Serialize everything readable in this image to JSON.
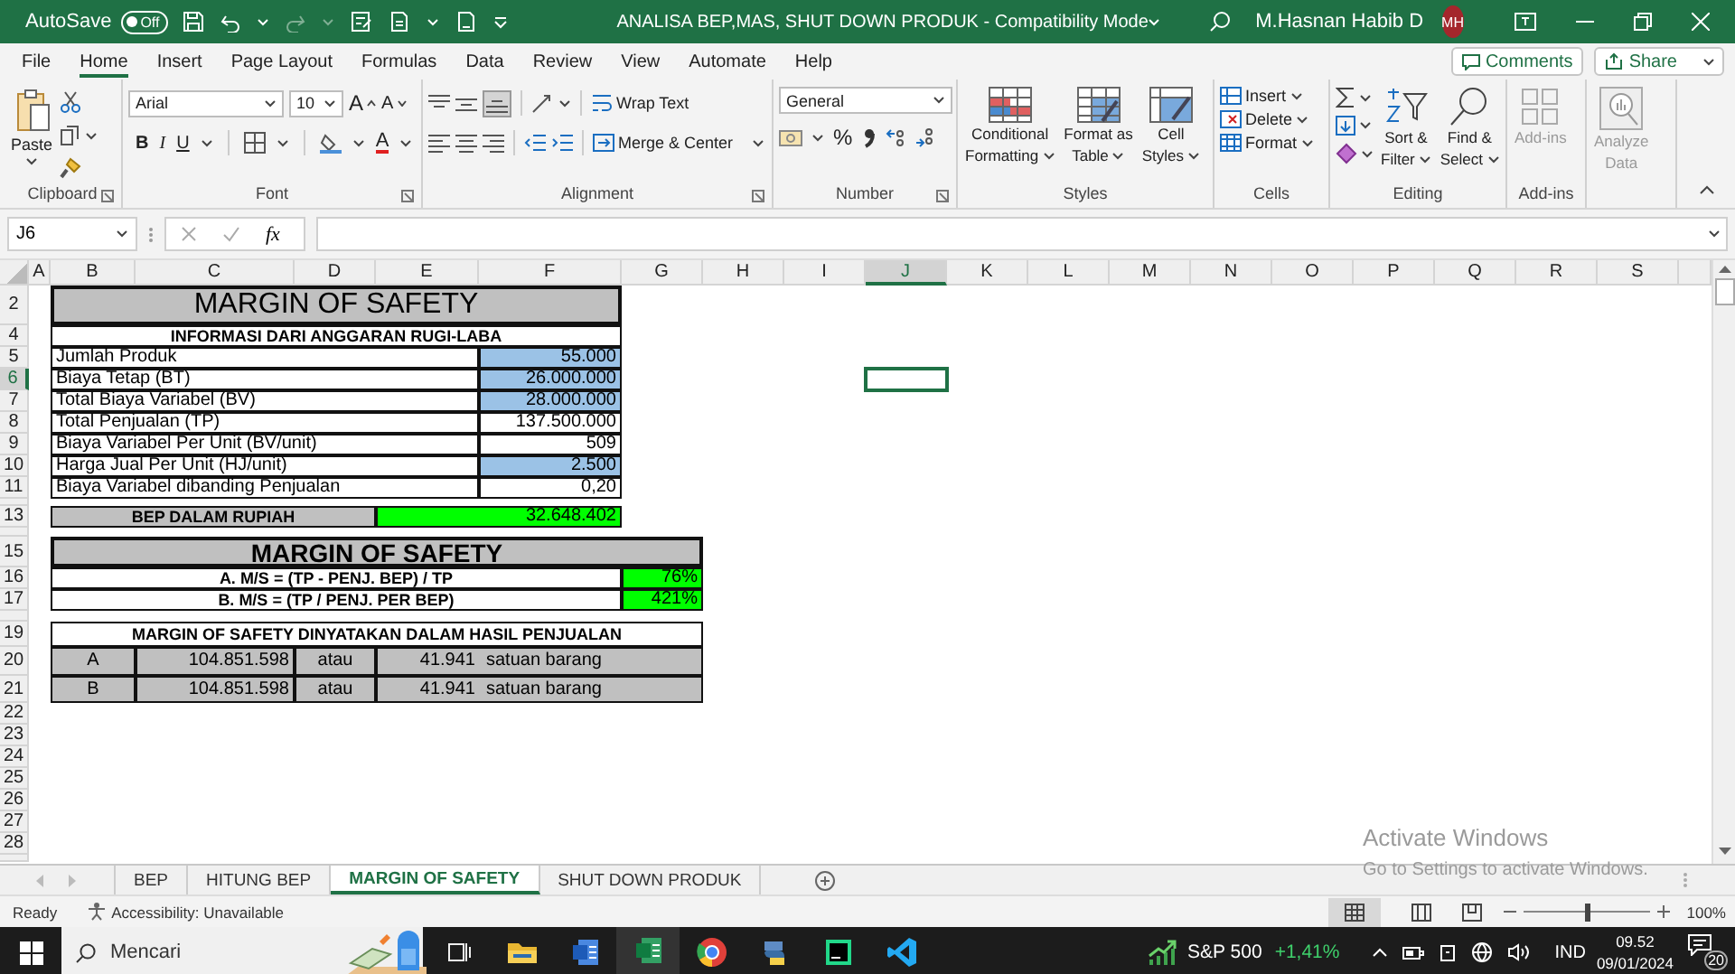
{
  "title_bar": {
    "autosave_label": "AutoSave",
    "autosave_toggle": {
      "label": "Off",
      "on": false
    },
    "document_title": "ANALISA BEP,MAS, SHUT DOWN PRODUK  -  Compatibility Mode",
    "user_name": "M.Hasnan Habib D",
    "avatar_initials": "MH"
  },
  "ribbon_tabs": [
    {
      "label": "File",
      "selected": false
    },
    {
      "label": "Home",
      "selected": true
    },
    {
      "label": "Insert",
      "selected": false
    },
    {
      "label": "Page Layout",
      "selected": false
    },
    {
      "label": "Formulas",
      "selected": false
    },
    {
      "label": "Data",
      "selected": false
    },
    {
      "label": "Review",
      "selected": false
    },
    {
      "label": "View",
      "selected": false
    },
    {
      "label": "Automate",
      "selected": false
    },
    {
      "label": "Help",
      "selected": false
    }
  ],
  "comments_button": "Comments",
  "share_button": "Share",
  "ribbon": {
    "clipboard": {
      "paste": "Paste",
      "label": "Clipboard"
    },
    "font": {
      "font_name": "Arial",
      "font_size": "10",
      "grow": "A",
      "shrink": "A",
      "bold": "B",
      "italic": "I",
      "underline": "U",
      "font_color": "A",
      "label": "Font"
    },
    "alignment": {
      "wrap_text": "Wrap Text",
      "merge": "Merge & Center",
      "label": "Alignment"
    },
    "number": {
      "format": "General",
      "percent": "%",
      "label": "Number"
    },
    "styles": {
      "buttons": [
        {
          "lines": [
            "Conditional",
            "Formatting"
          ]
        },
        {
          "lines": [
            "Format as",
            "Table"
          ]
        },
        {
          "lines": [
            "Cell",
            "Styles"
          ]
        }
      ],
      "label": "Styles"
    },
    "cells": {
      "buttons": [
        "Insert",
        "Delete",
        "Format"
      ],
      "label": "Cells"
    },
    "editing": {
      "buttons": [
        {
          "lines": [
            "Sort &",
            "Filter"
          ]
        },
        {
          "lines": [
            "Find &",
            "Select"
          ]
        }
      ],
      "label": "Editing"
    },
    "addins": {
      "button": {
        "lines": [
          "Add-ins"
        ],
        "disabled": true
      },
      "label": "Add-ins"
    },
    "analyze": {
      "button": {
        "lines": [
          "Analyze",
          "Data"
        ],
        "disabled": true
      }
    }
  },
  "formula_bar": {
    "name_box": "J6",
    "function_label": "fx"
  },
  "sheet": {
    "columns": [
      {
        "label": "A",
        "selected": false
      },
      {
        "label": "B",
        "selected": false
      },
      {
        "label": "C",
        "selected": false
      },
      {
        "label": "D",
        "selected": false
      },
      {
        "label": "E",
        "selected": false
      },
      {
        "label": "F",
        "selected": false
      },
      {
        "label": "G",
        "selected": false
      },
      {
        "label": "H",
        "selected": false
      },
      {
        "label": "I",
        "selected": false
      },
      {
        "label": "J",
        "selected": true
      },
      {
        "label": "K",
        "selected": false
      },
      {
        "label": "L",
        "selected": false
      },
      {
        "label": "M",
        "selected": false
      },
      {
        "label": "N",
        "selected": false
      },
      {
        "label": "O",
        "selected": false
      },
      {
        "label": "P",
        "selected": false
      },
      {
        "label": "Q",
        "selected": false
      },
      {
        "label": "R",
        "selected": false
      },
      {
        "label": "S",
        "selected": false
      }
    ],
    "rows": [
      {
        "kind": "row",
        "label": "2",
        "selected": false
      },
      {
        "kind": "row",
        "label": "4",
        "selected": false
      },
      {
        "kind": "row",
        "label": "5",
        "selected": false
      },
      {
        "kind": "row",
        "label": "6",
        "selected": true
      },
      {
        "kind": "row",
        "label": "7",
        "selected": false
      },
      {
        "kind": "row",
        "label": "8",
        "selected": false
      },
      {
        "kind": "row",
        "label": "9",
        "selected": false
      },
      {
        "kind": "row",
        "label": "10",
        "selected": false
      },
      {
        "kind": "row",
        "label": "11",
        "selected": false
      },
      {
        "kind": "collapsed"
      },
      {
        "kind": "row",
        "label": "13",
        "selected": false
      },
      {
        "kind": "collapsed"
      },
      {
        "kind": "row",
        "label": "15",
        "selected": false
      },
      {
        "kind": "row",
        "label": "16",
        "selected": false
      },
      {
        "kind": "row",
        "label": "17",
        "selected": false
      },
      {
        "kind": "collapsed"
      },
      {
        "kind": "row",
        "label": "19",
        "selected": false
      },
      {
        "kind": "row",
        "label": "20",
        "selected": false
      },
      {
        "kind": "row",
        "label": "21",
        "selected": false
      },
      {
        "kind": "row",
        "label": "22",
        "selected": false
      },
      {
        "kind": "row",
        "label": "23",
        "selected": false
      },
      {
        "kind": "row",
        "label": "24",
        "selected": false
      },
      {
        "kind": "row",
        "label": "25",
        "selected": false
      },
      {
        "kind": "row",
        "label": "26",
        "selected": false
      },
      {
        "kind": "row",
        "label": "27",
        "selected": false
      },
      {
        "kind": "row",
        "label": "28",
        "selected": false
      },
      {
        "kind": "collapsed"
      }
    ],
    "title": "MARGIN OF SAFETY",
    "info": {
      "header": "INFORMASI DARI ANGGARAN RUGI-LABA",
      "rows": [
        {
          "label": "Jumlah Produk",
          "value": "55.000",
          "highlighted": true
        },
        {
          "label": "Biaya Tetap (BT)",
          "value": "26.000.000",
          "highlighted": true
        },
        {
          "label": "Total Biaya Variabel (BV)",
          "value": "28.000.000",
          "highlighted": true
        },
        {
          "label": "Total Penjualan (TP)",
          "value": "137.500.000",
          "highlighted": false
        },
        {
          "label": "Biaya Variabel Per Unit (BV/unit)",
          "value": "509",
          "highlighted": false
        },
        {
          "label": "Harga Jual Per Unit (HJ/unit)",
          "value": "2.500",
          "highlighted": true
        },
        {
          "label": "Biaya Variabel dibanding Penjualan",
          "value": "0,20",
          "highlighted": false
        }
      ]
    },
    "bep": {
      "label": "BEP DALAM RUPIAH",
      "value": "32.648.402"
    },
    "margin": {
      "title": "MARGIN OF SAFETY",
      "rows": [
        {
          "label": "A. M/S = (TP - PENJ. BEP) / TP",
          "value": "76%"
        },
        {
          "label": "B. M/S = (TP / PENJ. PER BEP)",
          "value": "421%"
        }
      ]
    },
    "sales": {
      "title": "MARGIN OF SAFETY DINYATAKAN DALAM HASIL PENJUALAN",
      "rows": [
        {
          "label": "A",
          "amount": "104.851.598",
          "connector": "atau",
          "units": "41.941",
          "unit_label": "satuan barang"
        },
        {
          "label": "B",
          "amount": "104.851.598",
          "connector": "atau",
          "units": "41.941",
          "unit_label": "satuan barang"
        }
      ]
    }
  },
  "activation_notice": {
    "title": "Activate Windows",
    "message": "Go to Settings to activate Windows."
  },
  "sheet_tabs": [
    {
      "label": "BEP",
      "selected": false
    },
    {
      "label": "HITUNG BEP",
      "selected": false
    },
    {
      "label": "MARGIN OF SAFETY",
      "selected": true
    },
    {
      "label": "SHUT DOWN PRODUK",
      "selected": false
    }
  ],
  "status_bar": {
    "status": "Ready",
    "accessibility": "Accessibility: Unavailable",
    "zoom": "100%",
    "zoom_slider": {
      "level": 0.5
    }
  },
  "taskbar": {
    "search_placeholder": "Mencari",
    "apps": [
      {
        "kind": "task-view",
        "active": false
      },
      {
        "kind": "folder",
        "active": false
      },
      {
        "kind": "word",
        "active": false
      },
      {
        "kind": "excel",
        "active": true
      },
      {
        "kind": "chrome",
        "active": false
      },
      {
        "kind": "python",
        "active": false
      },
      {
        "kind": "pycharm",
        "active": false
      },
      {
        "kind": "vscode",
        "active": false
      }
    ],
    "stock_name": "S&P 500",
    "stock_change": "+1,41%",
    "language": "IND",
    "time": "09.52",
    "date": "09/01/2024",
    "notification_count": "20"
  }
}
